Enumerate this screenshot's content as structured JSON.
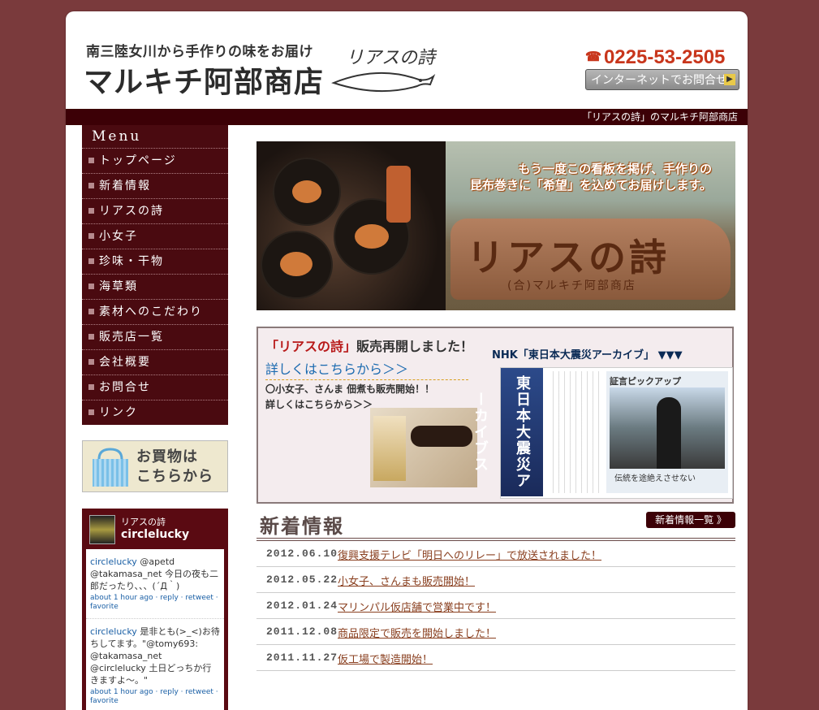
{
  "header": {
    "tagline": "南三陸女川から手作りの味をお届け",
    "shop_name": "マルキチ阿部商店",
    "logo_text": "リアスの詩",
    "phone": "0225-53-2505",
    "contact_button": "インターネットでお問合せ",
    "breadcrumb": "「リアスの詩」のマルキチ阿部商店"
  },
  "menu": {
    "heading": "Menu",
    "items": [
      {
        "label": "トップページ"
      },
      {
        "label": "新着情報"
      },
      {
        "label": "リアスの詩"
      },
      {
        "label": "小女子"
      },
      {
        "label": "珍味・干物"
      },
      {
        "label": "海草類"
      },
      {
        "label": "素材へのこだわり"
      },
      {
        "label": "販売店一覧"
      },
      {
        "label": "会社概要"
      },
      {
        "label": "お問合せ"
      },
      {
        "label": "リンク"
      }
    ]
  },
  "shop_banner": {
    "line1": "お買物は",
    "line2": "こちらから"
  },
  "twitter": {
    "title": "リアスの詩",
    "user": "circlelucky",
    "tweets": [
      {
        "author": "circlelucky",
        "text": "@apetd @takamasa_net 今日の夜も二郎だったり、、、(´Д｀)",
        "time": "about 1 hour ago",
        "actions": "· reply · retweet · favorite"
      },
      {
        "author": "circlelucky",
        "text": "是非とも(>_<)お待ちしてます。\"@tomy693: @takamasa_net @circlelucky 土日どっちか行きますよ〜。\"",
        "time": "about 1 hour ago",
        "actions": "· reply · retweet · favorite"
      }
    ]
  },
  "hero": {
    "caption_line1": "もう一度この看板を掲げ、手作りの",
    "caption_line2": "昆布巻きに「希望」を込めてお届けします。",
    "sign_text": "リアスの詩",
    "sign_sub": "(合)マルキチ阿部商店"
  },
  "news_box": {
    "title_prefix": "「リアスの詩」",
    "title_suffix": "販売再開しました！",
    "link1": "詳しくはこちらから＞＞",
    "line2": "〇小女子、さんま 佃煮も販売開始！！",
    "link2": "詳しくはこちらから＞＞",
    "nhk_title": "NHK「東日本大震災アーカイブ」 ▼▼▼",
    "nhk_vertical": "東日本大震災アーカイブス",
    "nhk_video_title": "証言ピックアップ",
    "nhk_caption": "伝統を途絶えさせない"
  },
  "news": {
    "heading": "新着情報",
    "all_button": "新着情報一覧 》",
    "items": [
      {
        "date": "2012.06.10",
        "title": "復興支援テレビ「明日へのリレー」で放送されました！"
      },
      {
        "date": "2012.05.22",
        "title": "小女子、さんまも販売開始！"
      },
      {
        "date": "2012.01.24",
        "title": "マリンパル仮店舗で営業中です！"
      },
      {
        "date": "2011.12.08",
        "title": "商品限定で販売を開始しました！"
      },
      {
        "date": "2011.11.27",
        "title": "仮工場で製造開始！"
      }
    ]
  },
  "colors": {
    "background": "#7a3a3c",
    "dark_maroon": "#3c0006",
    "phone_red": "#c8361c",
    "link_blue": "#1a6ab0"
  }
}
